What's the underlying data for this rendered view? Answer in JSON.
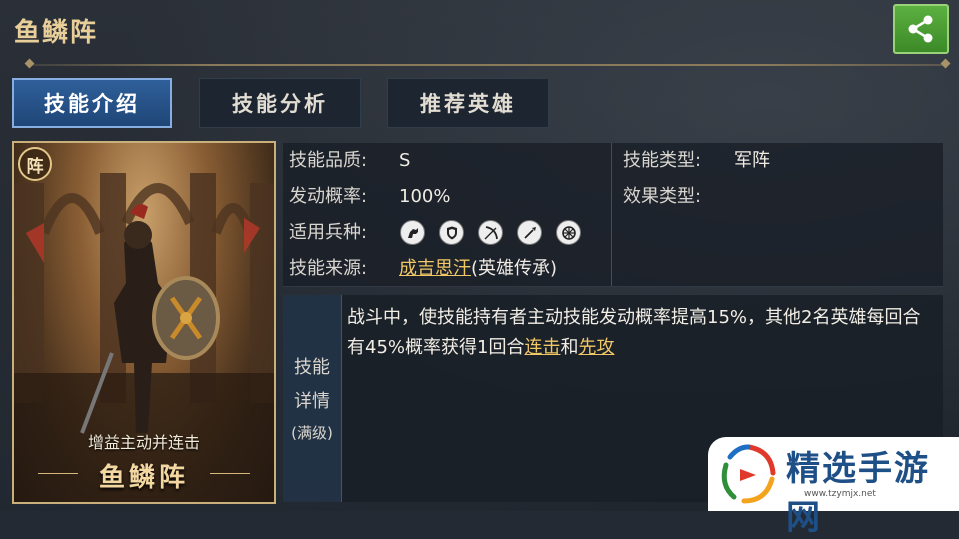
{
  "header": {
    "title": "鱼鳞阵"
  },
  "tabs": [
    {
      "label": "技能介绍",
      "active": true
    },
    {
      "label": "技能分析",
      "active": false
    },
    {
      "label": "推荐英雄",
      "active": false
    }
  ],
  "card": {
    "badge": "阵",
    "subtitle": "增益主动并连击",
    "name": "鱼鳞阵"
  },
  "info": {
    "quality_label": "技能品质:",
    "quality_value": "S",
    "type_label": "技能类型:",
    "type_value": "军阵",
    "rate_label": "发动概率:",
    "rate_value": "100%",
    "effect_label": "效果类型:",
    "effect_value": "",
    "troops_label": "适用兵种:",
    "troop_icons": [
      "cavalry-icon",
      "shield-icon",
      "bow-icon",
      "spear-icon",
      "chariot-wheel-icon"
    ],
    "source_label": "技能来源:",
    "source_link": "成吉思汗",
    "source_suffix": "(英雄传承)"
  },
  "detail": {
    "label_line1": "技能",
    "label_line2": "详情",
    "label_line3": "(满级)",
    "text_part1": "战斗中，使技能持有者主动技能发动概率提高15%，其他2名英雄每回合有45%概率获得1回合",
    "link1": "连击",
    "text_part2": "和",
    "link2": "先攻"
  },
  "watermark": {
    "text": "精选手游网",
    "url": "www.tzymjx.net"
  },
  "colors": {
    "accent_gold": "#e8cf9a",
    "active_tab": "#2f5f9a",
    "share_green": "#4a9e34",
    "link": "#f2c766"
  }
}
